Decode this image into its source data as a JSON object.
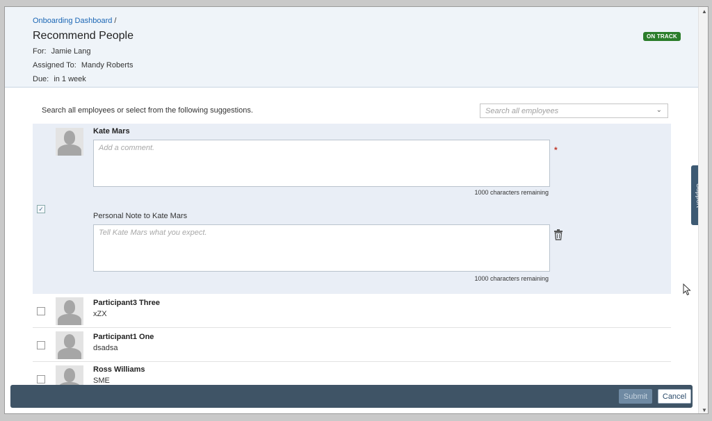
{
  "breadcrumb": {
    "link": "Onboarding Dashboard",
    "separator": "/"
  },
  "page_title": "Recommend People",
  "meta": {
    "for_label": "For:",
    "for_value": "Jamie Lang",
    "assigned_label": "Assigned To:",
    "assigned_value": "Mandy Roberts",
    "due_label": "Due:",
    "due_value": "in 1 week"
  },
  "status_badge": {
    "text": "ON TRACK",
    "color": "#2b7d2b"
  },
  "search": {
    "hint": "Search all employees or select from the following suggestions.",
    "placeholder": "Search all employees"
  },
  "selected_person": {
    "name": "Kate Mars",
    "comment_placeholder": "Add a comment.",
    "comment_remaining": "1000 characters remaining",
    "note_label": "Personal Note to Kate Mars",
    "note_placeholder": "Tell Kate Mars what you expect.",
    "note_remaining": "1000 characters remaining",
    "required_mark": "*"
  },
  "people": [
    {
      "name": "Participant3 Three",
      "detail": "xZX"
    },
    {
      "name": "Participant1 One",
      "detail": "dsadsa"
    },
    {
      "name": "Ross Williams",
      "detail": "SME"
    }
  ],
  "support_tab": "Support",
  "footer": {
    "submit_label": "Submit",
    "cancel_label": "Cancel"
  },
  "icons": {
    "trash": "trash-icon",
    "dropdown": "chevron-down-icon",
    "avatar": "person-placeholder-icon"
  }
}
